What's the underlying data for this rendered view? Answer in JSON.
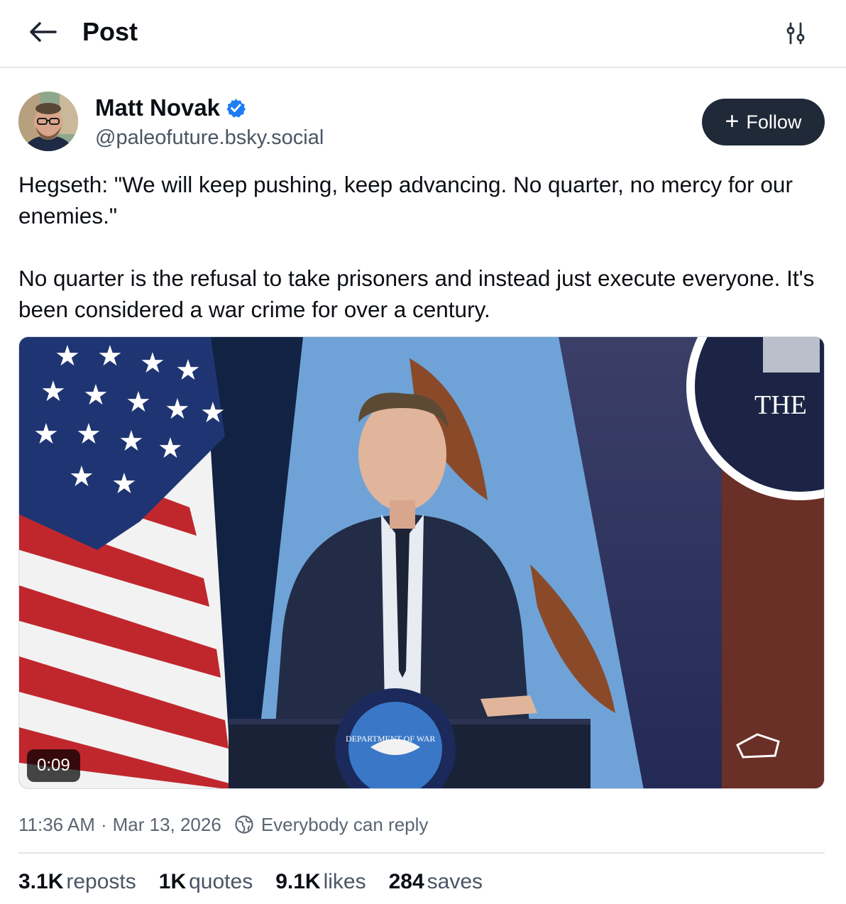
{
  "header": {
    "back_icon": "arrow-left-icon",
    "title": "Post",
    "settings_icon": "sliders-icon"
  },
  "author": {
    "name": "Matt Novak",
    "verified_icon": "verified-check-icon",
    "handle": "@paleofuture.bsky.social"
  },
  "follow_button": {
    "icon": "plus-icon",
    "label": "Follow"
  },
  "post": {
    "paragraph_1": "Hegseth: \"We will keep pushing, keep advancing. No quarter, no mercy for our enemies.\"",
    "paragraph_2": "No quarter is the refusal to take prisoners and instead just execute everyone. It's been considered a war crime for over a century."
  },
  "video": {
    "duration": "0:09",
    "seal_text": "DEPARTMENT OF WAR",
    "backdrop_text": "THE"
  },
  "meta": {
    "time": "11:36 AM",
    "separator": "·",
    "date": "Mar 13, 2026",
    "reply_icon": "globe-icon",
    "reply_setting": "Everybody can reply"
  },
  "stats": [
    {
      "count": "3.1K",
      "label": "reposts"
    },
    {
      "count": "1K",
      "label": "quotes"
    },
    {
      "count": "9.1K",
      "label": "likes"
    },
    {
      "count": "284",
      "label": "saves"
    }
  ],
  "colors": {
    "follow_bg": "#1f2937",
    "verified": "#1d7df2",
    "muted_text": "#4a5564"
  }
}
